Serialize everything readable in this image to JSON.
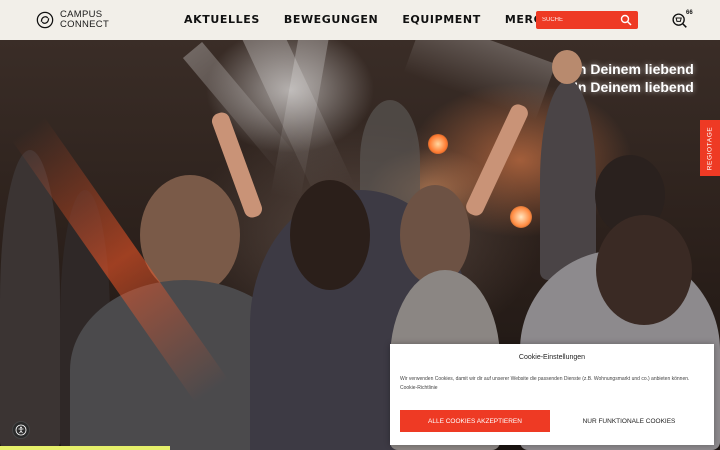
{
  "header": {
    "logo_line1": "CAMPUS",
    "logo_line2": "CONNECT",
    "nav": [
      "AKTUELLES",
      "BEWEGUNGEN",
      "EQUIPMENT",
      "MERCH"
    ],
    "search_placeholder": "SUCHE",
    "cart_count": "66"
  },
  "hero": {
    "stage_text_line1": "In Deinem liebend",
    "stage_text_line2": "In Deinem liebend"
  },
  "side_tab": {
    "label": "REGIOTAGE"
  },
  "cookie": {
    "title": "Cookie-Einstellungen",
    "text": "Wir verwenden Cookies, damit wir dir auf unserer Website die passenden Dienste (z.B. Wohnungsmarkt und co.) anbieten können.",
    "link": "Cookie-Richtlinie",
    "accept_label": "ALLE COOKIES AKZEPTIEREN",
    "functional_label": "NUR FUNKTIONALE COOKIES"
  },
  "colors": {
    "accent": "#ee3a24",
    "header_bg": "#f2efe9",
    "bottom_bar": "#e6f06a"
  },
  "icons": [
    "campus-connect-logo-icon",
    "search-icon",
    "cart-icon",
    "accessibility-icon"
  ]
}
